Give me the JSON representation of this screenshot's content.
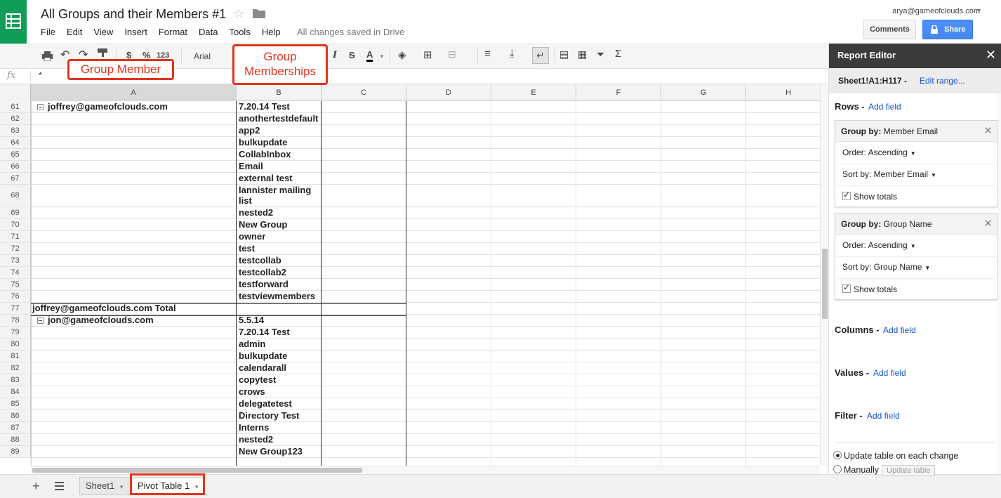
{
  "header": {
    "title": "All Groups and their Members #1",
    "menu": [
      "File",
      "Edit",
      "View",
      "Insert",
      "Format",
      "Data",
      "Tools",
      "Help"
    ],
    "save_status": "All changes saved in Drive",
    "user_email": "arya@gameofclouds.com",
    "comments_label": "Comments",
    "share_label": "Share"
  },
  "toolbar": {
    "currency": "$",
    "percent": "%",
    "number_format": "123",
    "font": "Arial"
  },
  "formula": {
    "fx": "fx",
    "value": "*"
  },
  "columns": [
    "A",
    "B",
    "C",
    "D",
    "E",
    "F",
    "G",
    "H"
  ],
  "rows": [
    {
      "num": "61",
      "a": "joffrey@gameofclouds.com",
      "b": "7.20.14 Test"
    },
    {
      "num": "62",
      "a": "",
      "b": "anothertestdefault"
    },
    {
      "num": "63",
      "a": "",
      "b": "app2"
    },
    {
      "num": "64",
      "a": "",
      "b": "bulkupdate"
    },
    {
      "num": "65",
      "a": "",
      "b": "CollabInbox"
    },
    {
      "num": "66",
      "a": "",
      "b": "Email"
    },
    {
      "num": "67",
      "a": "",
      "b": "external test"
    },
    {
      "num": "68",
      "a": "",
      "b": "lannister mailing list"
    },
    {
      "num": "69",
      "a": "",
      "b": "nested2"
    },
    {
      "num": "70",
      "a": "",
      "b": "New Group"
    },
    {
      "num": "71",
      "a": "",
      "b": "owner"
    },
    {
      "num": "72",
      "a": "",
      "b": "test"
    },
    {
      "num": "73",
      "a": "",
      "b": "testcollab"
    },
    {
      "num": "74",
      "a": "",
      "b": "testcollab2"
    },
    {
      "num": "75",
      "a": "",
      "b": "testforward"
    },
    {
      "num": "76",
      "a": "",
      "b": "testviewmembers"
    },
    {
      "num": "77",
      "a": "joffrey@gameofclouds.com Total",
      "b": ""
    },
    {
      "num": "78",
      "a": "jon@gameofclouds.com",
      "b": "5.5.14"
    },
    {
      "num": "79",
      "a": "",
      "b": "7.20.14 Test"
    },
    {
      "num": "80",
      "a": "",
      "b": "admin"
    },
    {
      "num": "81",
      "a": "",
      "b": "bulkupdate"
    },
    {
      "num": "82",
      "a": "",
      "b": "calendarall"
    },
    {
      "num": "83",
      "a": "",
      "b": "copytest"
    },
    {
      "num": "84",
      "a": "",
      "b": "crows"
    },
    {
      "num": "85",
      "a": "",
      "b": "delegatetest"
    },
    {
      "num": "86",
      "a": "",
      "b": "Directory Test"
    },
    {
      "num": "87",
      "a": "",
      "b": "Interns"
    },
    {
      "num": "88",
      "a": "",
      "b": "nested2"
    },
    {
      "num": "89",
      "a": "",
      "b": "New Group123"
    }
  ],
  "sheets": {
    "sheet1": "Sheet1",
    "pivot": "Pivot Table 1"
  },
  "report_editor": {
    "title": "Report Editor",
    "range": "Sheet1!A1:H117 -",
    "edit_range": "Edit range...",
    "rows_label": "Rows -",
    "add_field": "Add field",
    "group1": {
      "label": "Group by:",
      "field": "Member Email",
      "order": "Order: Ascending",
      "sort": "Sort by: Member Email",
      "totals": "Show totals"
    },
    "group2": {
      "label": "Group by:",
      "field": "Group Name",
      "order": "Order: Ascending",
      "sort": "Sort by: Group Name",
      "totals": "Show totals"
    },
    "columns_label": "Columns -",
    "values_label": "Values -",
    "filter_label": "Filter -",
    "update_each": "Update table on each change",
    "manually": "Manually",
    "update_table": "Update table"
  },
  "annotations": {
    "group_member": "Group Member",
    "group_memberships": "Group Memberships"
  },
  "colors": {
    "brand_green": "#0f9d58",
    "share_blue": "#4d90fe",
    "annotation_red": "#e2341d",
    "link_blue": "#1155cc"
  }
}
